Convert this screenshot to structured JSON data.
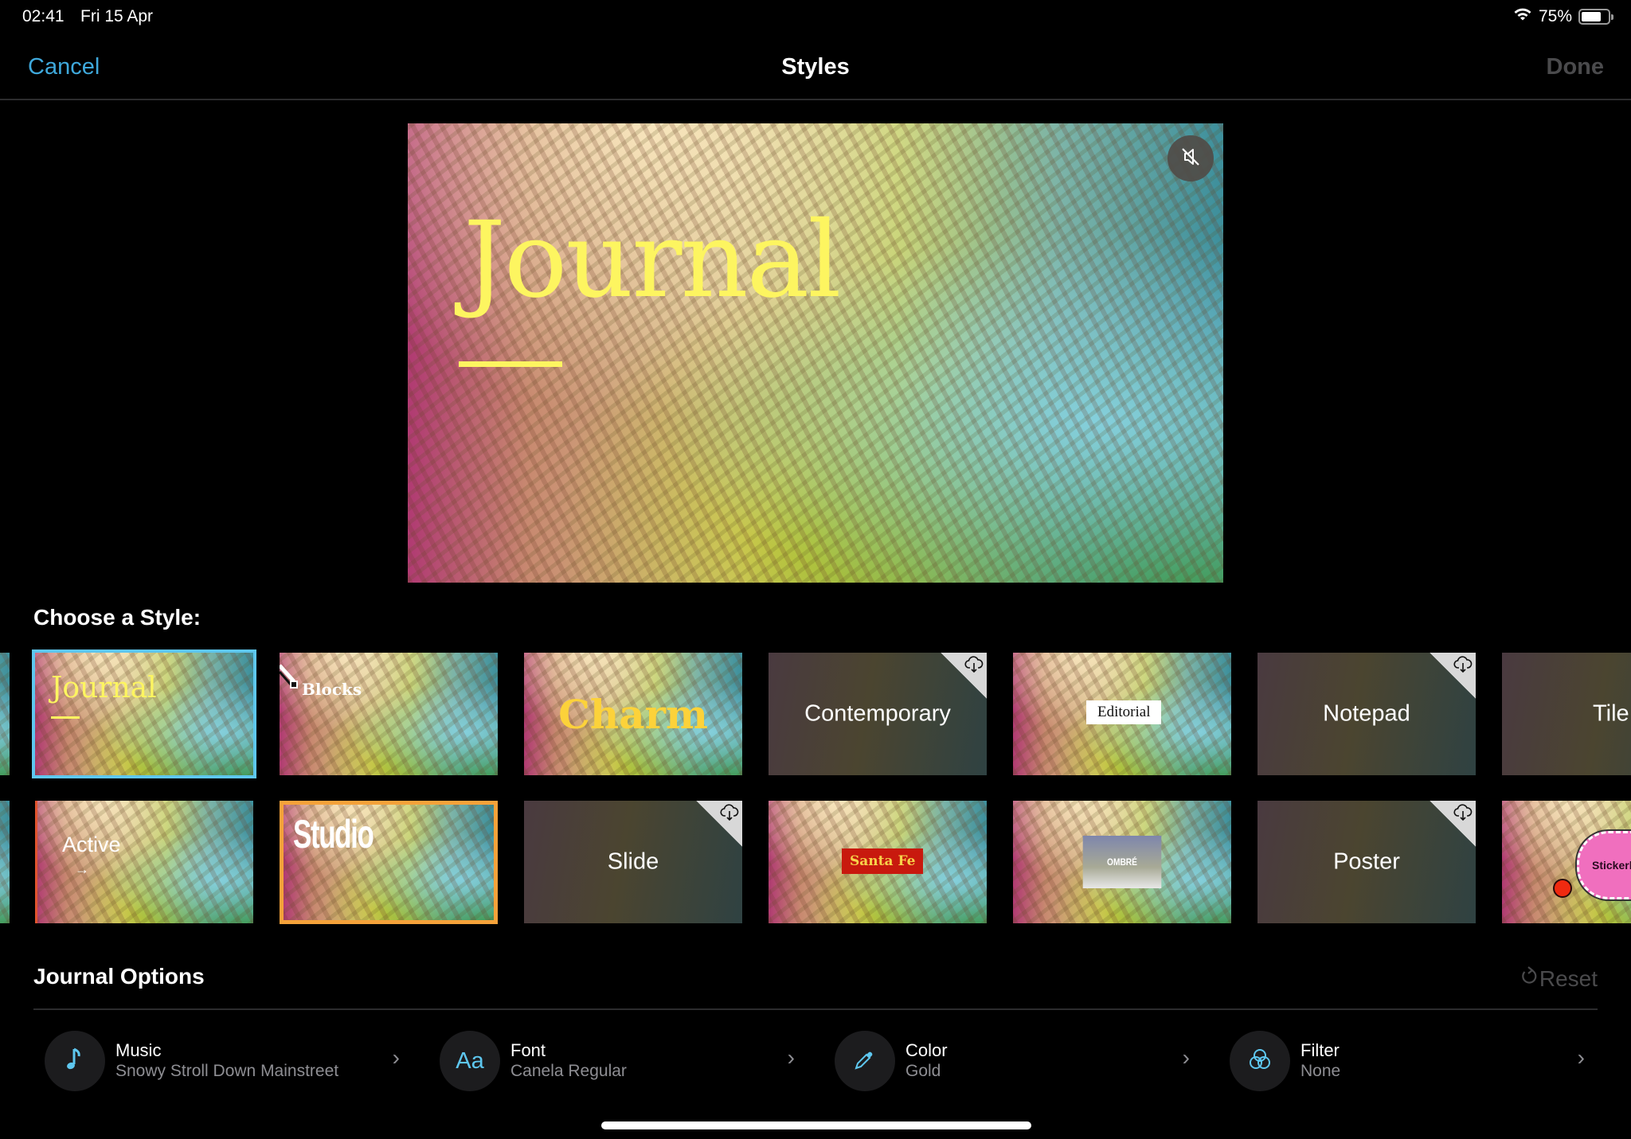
{
  "status_bar": {
    "time": "02:41",
    "date": "Fri 15 Apr",
    "battery_percent": "75%",
    "battery_level": 0.75
  },
  "nav": {
    "cancel": "Cancel",
    "title": "Styles",
    "done": "Done"
  },
  "preview": {
    "title": "Journal",
    "title_color": "#fdf560",
    "mute_icon": "speaker-muted-icon"
  },
  "choose_label": "Choose a Style:",
  "styles_row1": [
    {
      "label": "",
      "kind": "partial-photo"
    },
    {
      "label": "Journal",
      "kind": "photo",
      "selected": true
    },
    {
      "label": "Blocks",
      "kind": "photo"
    },
    {
      "label": "Charm",
      "kind": "photo"
    },
    {
      "label": "Contemporary",
      "kind": "download"
    },
    {
      "label": "Editorial",
      "kind": "photo"
    },
    {
      "label": "Notepad",
      "kind": "download"
    },
    {
      "label": "Tile",
      "kind": "partial-dark"
    }
  ],
  "styles_row2": [
    {
      "label": "",
      "kind": "partial-photo"
    },
    {
      "label": "Active",
      "arrow": "→",
      "kind": "photo"
    },
    {
      "label": "Studio",
      "kind": "photo",
      "highlighted": true
    },
    {
      "label": "Slide",
      "kind": "download"
    },
    {
      "label": "Santa Fe",
      "kind": "photo"
    },
    {
      "label": "OMBRÉ",
      "kind": "photo"
    },
    {
      "label": "Poster",
      "kind": "download"
    },
    {
      "label": "Stickerbook",
      "kind": "partial-photo"
    }
  ],
  "options": {
    "title": "Journal Options",
    "reset": "Reset",
    "items": [
      {
        "label": "Music",
        "value": "Snowy Stroll Down Mainstreet",
        "icon": "music-note-icon"
      },
      {
        "label": "Font",
        "value": "Canela Regular",
        "icon": "font-aa-icon",
        "glyph": "Aa"
      },
      {
        "label": "Color",
        "value": "Gold",
        "icon": "eyedropper-icon"
      },
      {
        "label": "Filter",
        "value": "None",
        "icon": "filter-circles-icon"
      }
    ]
  },
  "colors": {
    "accent": "#3fa9dc",
    "selected_border": "#5ec7ef",
    "studio_border": "#f5a23a",
    "disabled": "#4a4a4c"
  }
}
